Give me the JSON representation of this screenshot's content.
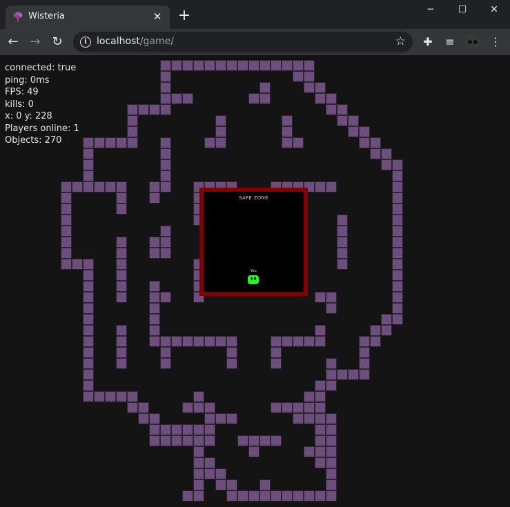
{
  "browser": {
    "tab_title": "Wisteria",
    "tab_close": "✕",
    "new_tab": "+",
    "url_host": "localhost",
    "url_path": "/game/",
    "window_controls": {
      "minimize": "─",
      "maximize": "☐",
      "close": "✕"
    }
  },
  "hud": {
    "connected": "connected: true",
    "ping": "ping: 0ms",
    "fps": "FPS: 49",
    "kills": "kills: 0",
    "position": "x: 0 y: 228",
    "players_online": "Players online: 1",
    "objects": "Objects: 270"
  },
  "game": {
    "safe_zone_label": "SAFE ZONE",
    "player_label": "You",
    "colors": {
      "wall": "#6d4f7c",
      "safe_zone_border": "#820000",
      "player": "#19ff19",
      "background": "#141414"
    }
  }
}
